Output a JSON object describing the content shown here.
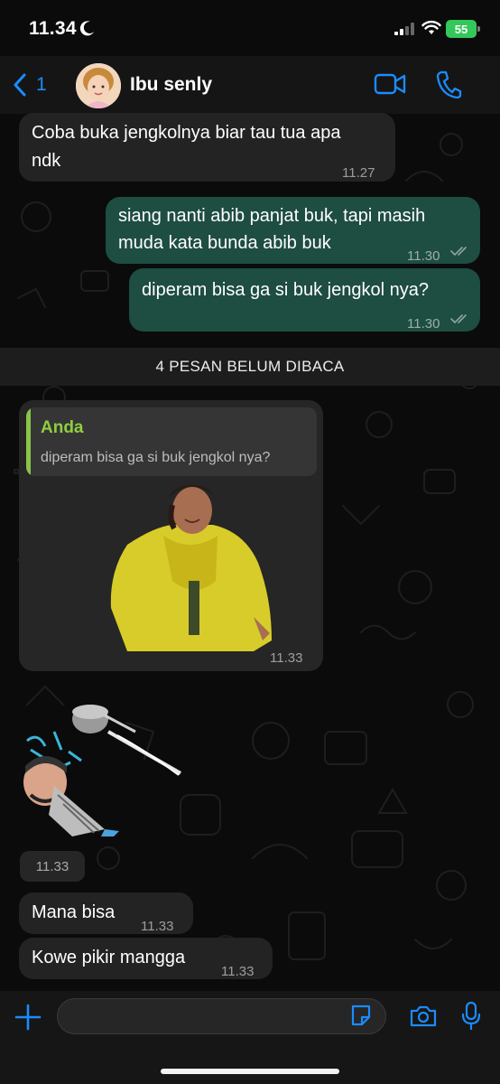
{
  "status_bar": {
    "time": "11.34",
    "battery_level": "55"
  },
  "header": {
    "back_count": "1",
    "contact_name": "Ibu senly"
  },
  "messages": [
    {
      "direction": "in",
      "lines": [
        "Coba buka jengkolnya biar tau tua apa",
        "ndk"
      ],
      "time": "11.27"
    },
    {
      "direction": "out",
      "lines": [
        "siang nanti abib panjat buk, tapi masih",
        "muda kata bunda abib buk"
      ],
      "time": "11.30",
      "status": "read"
    },
    {
      "direction": "out",
      "lines": [
        "diperam bisa ga si buk jengkol nya?"
      ],
      "time": "11.30",
      "status": "read"
    }
  ],
  "unread_banner": "4 PESAN BELUM DIBACA",
  "reply_sticker": {
    "quote_author": "Anda",
    "quote_text": "diperam bisa ga si buk jengkol nya?",
    "time": "11.33"
  },
  "sticker_time": "11.33",
  "incoming_short": [
    {
      "text": "Mana bisa",
      "time": "11.33"
    },
    {
      "text": "Kowe pikir mangga",
      "time": "11.33"
    }
  ],
  "input": {
    "placeholder": ""
  },
  "colors": {
    "outgoing_bubble": "#1e4d42",
    "incoming_bubble": "#232323",
    "accent": "#1a8cff",
    "quote_author": "#8fcf3f"
  }
}
